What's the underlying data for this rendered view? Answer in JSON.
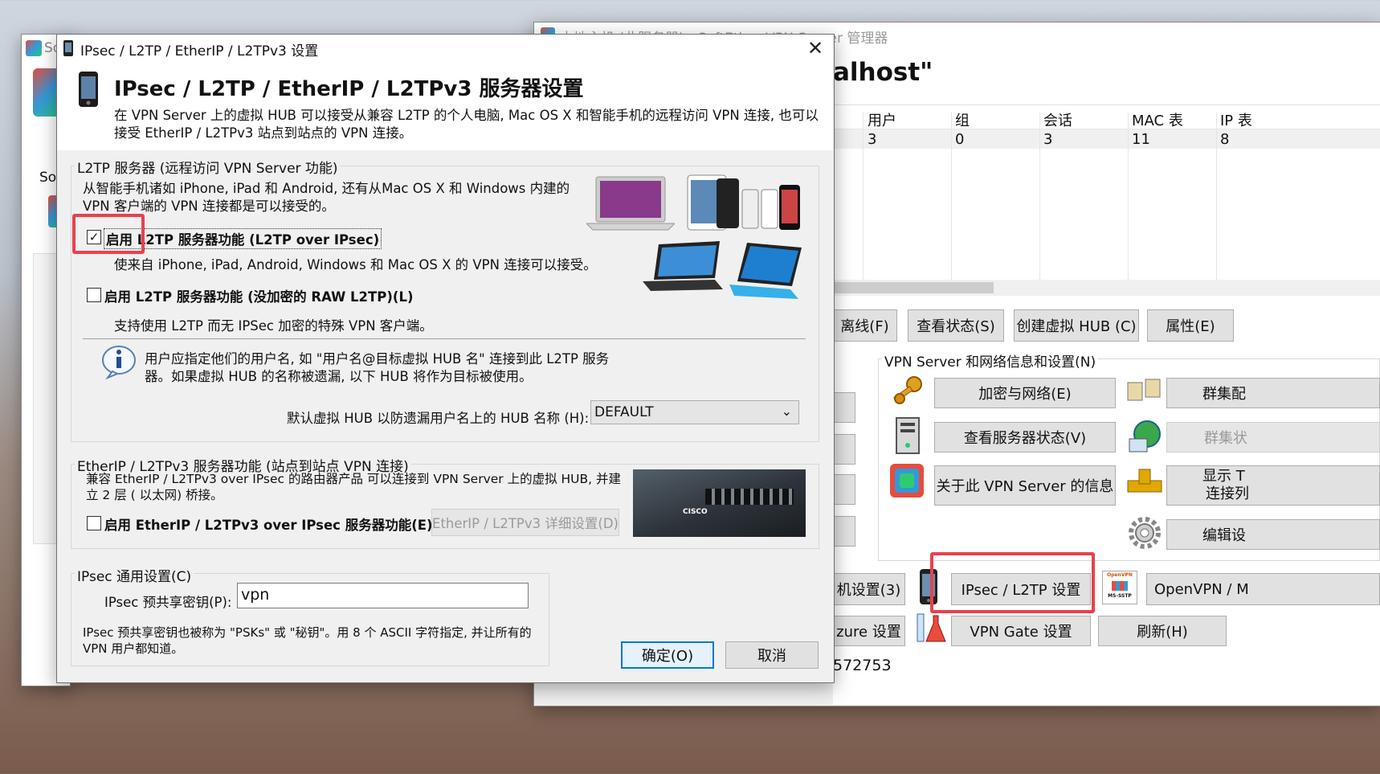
{
  "background_window": {
    "title": "本地主机 (此服务器) - SoftEther VPN Server 管理器",
    "heading_fragment": "alhost\"",
    "columns": [
      "用户",
      "组",
      "会话",
      "MAC 表",
      "IP 表"
    ],
    "row": [
      "3",
      "0",
      "3",
      "11",
      "8"
    ],
    "buttons": {
      "offline": "离线(F)",
      "view_status": "查看状态(S)",
      "create_hub": "创建虚拟 HUB (C)",
      "properties": "属性(E)",
      "encryption": "加密与网络(E)",
      "server_status": "查看服务器状态(V)",
      "about": "关于此 VPN Server 的信息",
      "cluster_config": "群集配",
      "cluster_status": "群集状",
      "show_tcp_line1": "显示 T",
      "show_tcp_line2": "连接列",
      "edit_config": "编辑设",
      "local_bridge": "机设置(3)",
      "ipsec_l2tp": "IPsec / L2TP 设置",
      "openvpn": "OpenVPN / M",
      "azure": "zure 设置",
      "vpngate": "VPN Gate 设置",
      "refresh": "刷新(H)"
    },
    "section_label": "VPN Server 和网络信息和设置(N)",
    "footer_fragment": "572753",
    "openvpn_icon_top": "OpenVPN",
    "openvpn_icon_bottom": "MS-SSTP"
  },
  "left_window": {
    "title_fragment": "So",
    "label_fragment": "Sof"
  },
  "dialog": {
    "title": "IPsec / L2TP / EtherIP / L2TPv3 设置",
    "heading": "IPsec / L2TP / EtherIP / L2TPv3 服务器设置",
    "description": "在 VPN Server 上的虚拟 HUB 可以接受从兼容 L2TP 的个人电脑, Mac OS X 和智能手机的远程访问 VPN 连接, 也可以接受 EtherIP / L2TPv3 站点到站点的 VPN 连接。",
    "l2tp_group": {
      "label": "L2TP 服务器 (远程访问 VPN Server 功能)",
      "intro": "从智能手机诸如 iPhone, iPad 和 Android, 还有从Mac OS X 和 Windows 内建的 VPN 客户端的 VPN 连接都是可以接受的。",
      "enable_ipsec_label": "启用 L2TP 服务器功能 (L2TP over IPsec)",
      "enable_ipsec_desc": "使来自 iPhone, iPad, Android, Windows 和 Mac OS X 的 VPN 连接可以接受。",
      "enable_raw_label": "启用 L2TP 服务器功能 (没加密的 RAW L2TP)(L)",
      "enable_raw_desc": "支持使用 L2TP 而无 IPSec 加密的特殊 VPN 客户端。",
      "info_text": "用户应指定他们的用户名, 如 \"用户名@目标虚拟 HUB 名\" 连接到此 L2TP 服务器。如果虚拟 HUB 的名称被遗漏, 以下 HUB 将作为目标被使用。",
      "default_hub_label": "默认虚拟 HUB 以防遗漏用户名上的 HUB 名称 (H):",
      "default_hub_value": "DEFAULT"
    },
    "etherip_group": {
      "label": "EtherIP / L2TPv3 服务器功能 (站点到站点 VPN 连接)",
      "desc": "兼容 EtherIP / L2TPv3 over IPsec 的路由器产品 可以连接到 VPN Server 上的虚拟 HUB, 并建立 2 层 ( 以太网) 桥接。",
      "enable_label": "启用 EtherIP / L2TPv3 over IPsec 服务器功能(E)",
      "detail_button": "EtherIP / L2TPv3 详细设置(D)",
      "router_brand": "CISCO"
    },
    "ipsec_group": {
      "label": "IPsec 通用设置(C)",
      "psk_label": "IPsec 预共享密钥(P):",
      "psk_value": "vpn",
      "psk_note": "IPsec 预共享密钥也被称为 \"PSKs\" 或 \"秘钥\"。用 8 个 ASCII 字符指定, 并让所有的 VPN 用户都知道。"
    },
    "ok_button": "确定(O)",
    "cancel_button": "取消",
    "checkbox_states": {
      "ipsec": true,
      "raw": false,
      "etherip": false
    },
    "accent_color": "#0078d7",
    "highlight_color": "#e8414f"
  }
}
